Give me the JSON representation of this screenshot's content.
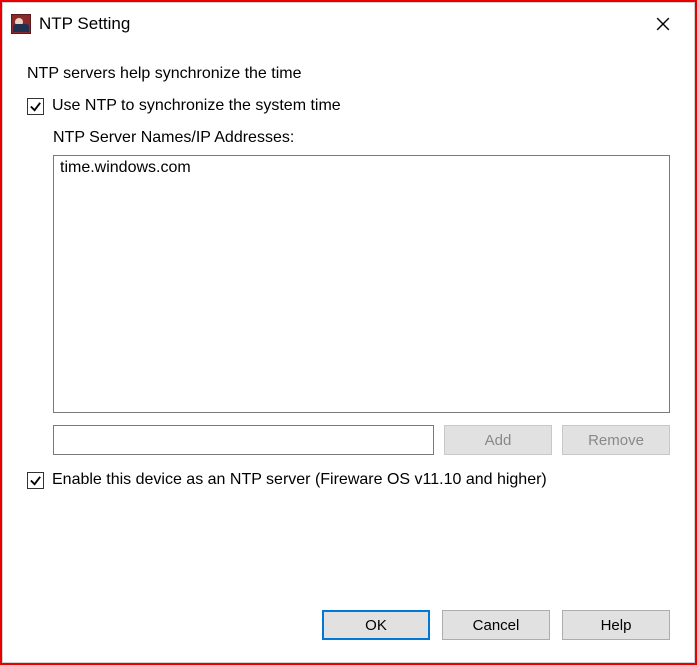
{
  "window": {
    "title": "NTP Setting"
  },
  "helpText": "NTP servers help synchronize the time",
  "useNtp": {
    "checked": true,
    "label": "Use NTP to synchronize the system time"
  },
  "serverList": {
    "label": "NTP Server Names/IP Addresses:",
    "items": [
      "time.windows.com"
    ]
  },
  "newServerInput": "",
  "buttons": {
    "add": "Add",
    "remove": "Remove",
    "ok": "OK",
    "cancel": "Cancel",
    "help": "Help"
  },
  "enableAsServer": {
    "checked": true,
    "label": "Enable this device as an NTP server (Fireware OS v11.10 and higher)"
  }
}
